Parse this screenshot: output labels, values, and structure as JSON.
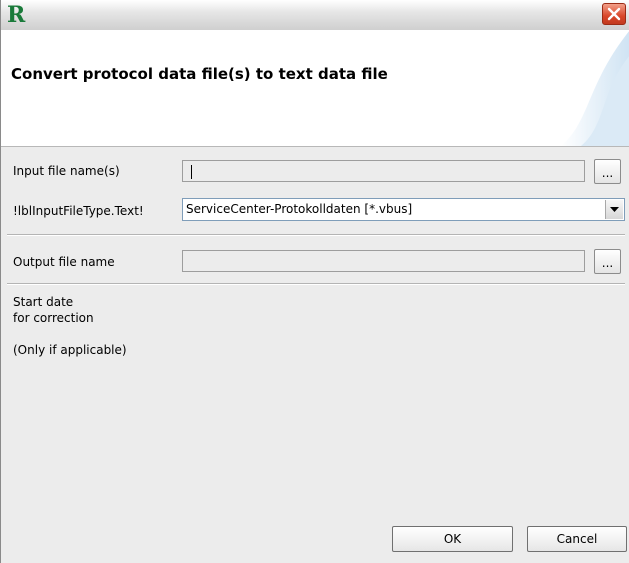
{
  "window": {
    "app_logo": "R",
    "close_icon": "close-icon",
    "header_title": "Convert protocol data file(s) to text data file"
  },
  "form": {
    "input_files_label": "Input file name(s)",
    "input_files_value": "",
    "input_browse_label": "...",
    "file_type_label": "!lblInputFileType.Text!",
    "file_type_selected": "ServiceCenter-Protokolldaten [*.vbus]",
    "output_file_label": "Output file name",
    "output_file_value": "",
    "output_browse_label": "...",
    "start_date_label_line1": "Start date",
    "start_date_label_line2": "for correction",
    "start_date_note": "(Only if applicable)"
  },
  "buttons": {
    "ok_label": "OK",
    "cancel_label": "Cancel"
  },
  "colors": {
    "logo": "#1a7a3a",
    "close_button": "#d9472a",
    "content_background": "#ececec"
  }
}
